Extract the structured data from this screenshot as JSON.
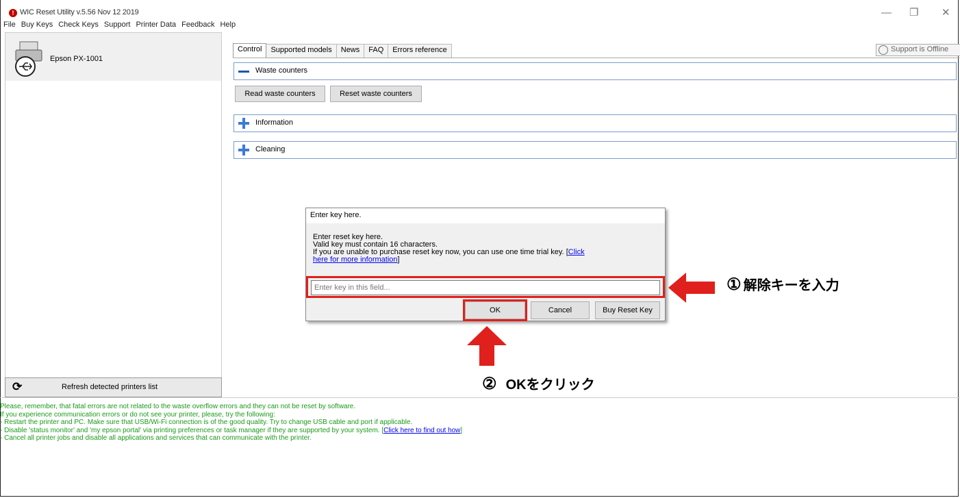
{
  "window": {
    "title": "WIC Reset Utility v.5.56 Nov 12 2019",
    "app_icon_glyph": "!",
    "minimize_glyph": "—",
    "restore_glyph": "❐",
    "close_glyph": "✕"
  },
  "menu": [
    "File",
    "Buy Keys",
    "Check Keys",
    "Support",
    "Printer Data",
    "Feedback",
    "Help"
  ],
  "printers": {
    "selected_name": "Epson PX-1001",
    "icon": "printer-usb-icon",
    "refresh_label": "Refresh detected printers list",
    "refresh_icon": "refresh-icon"
  },
  "tabs": [
    "Control",
    "Supported models",
    "News",
    "FAQ",
    "Errors reference"
  ],
  "support_status": "Support is Offline",
  "sections": {
    "waste": "Waste counters",
    "read_button": "Read waste counters",
    "reset_button": "Reset waste counters",
    "information": "Information",
    "cleaning": "Cleaning"
  },
  "dialog": {
    "title": "Enter key here.",
    "line1": "Enter reset key here.",
    "line2": "Valid key must contain 16 characters.",
    "line3": "If you are unable to purchase reset key now, you can use one time trial key. [",
    "link1": "Click",
    "link2": "here for more information",
    "line3_end": "]",
    "input_placeholder": "Enter key in this field...",
    "ok": "OK",
    "cancel": "Cancel",
    "buy": "Buy Reset Key"
  },
  "annotations": {
    "step1_num": "①",
    "step1_text": "解除キーを入力",
    "step2_num": "②",
    "step2_text": "OKをクリック",
    "highlight_color": "#e0201c"
  },
  "log": {
    "line1": "Please, remember, that fatal errors are not related to the waste overflow errors and they can not be reset by software.",
    "line2": "If you experience communication errors or do not see your printer, please, try the following:",
    "line3": "- Restart the printer and PC. Make sure that USB/Wi-Fi connection is of the good quality. Try to change USB cable and port if applicable.",
    "line4": "- Disable 'status monitor' and 'my epson portal' via printing preferences or task manager if they are supported by your system. [",
    "line4_link": "Click here to find out how",
    "line4_end": "]",
    "line5": "- Cancel all printer jobs and disable all applications and services that can communicate with the printer."
  },
  "colors": {
    "log_text": "#1a9a1a",
    "section_border": "#7a9ccf",
    "accent_blue": "#3d7bd8"
  }
}
